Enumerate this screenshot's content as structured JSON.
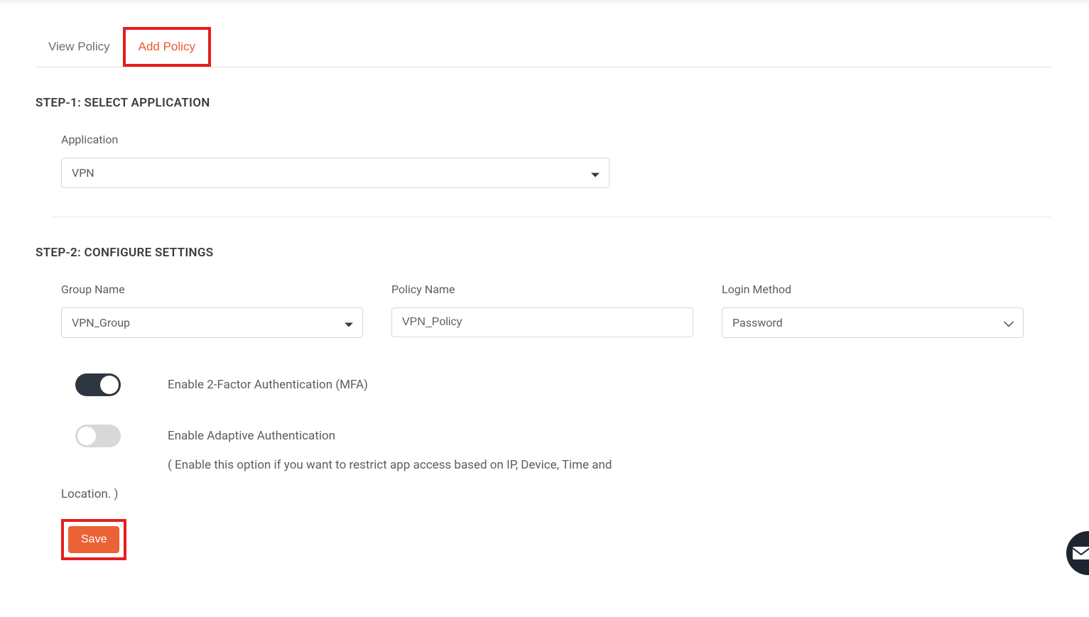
{
  "tabs": {
    "view_policy": "View Policy",
    "add_policy": "Add Policy"
  },
  "step1": {
    "title": "STEP-1: SELECT APPLICATION",
    "application_label": "Application",
    "application_value": "VPN"
  },
  "step2": {
    "title": "STEP-2: CONFIGURE SETTINGS",
    "group_name_label": "Group Name",
    "group_name_value": "VPN_Group",
    "policy_name_label": "Policy Name",
    "policy_name_value": "VPN_Policy",
    "login_method_label": "Login Method",
    "login_method_value": "Password",
    "mfa_label": "Enable 2-Factor Authentication (MFA)",
    "adaptive_label": "Enable Adaptive Authentication",
    "adaptive_hint_part1": "( Enable this option if you want to restrict app access based on IP, Device, Time and",
    "adaptive_hint_part2": "Location. )"
  },
  "buttons": {
    "save": "Save"
  }
}
